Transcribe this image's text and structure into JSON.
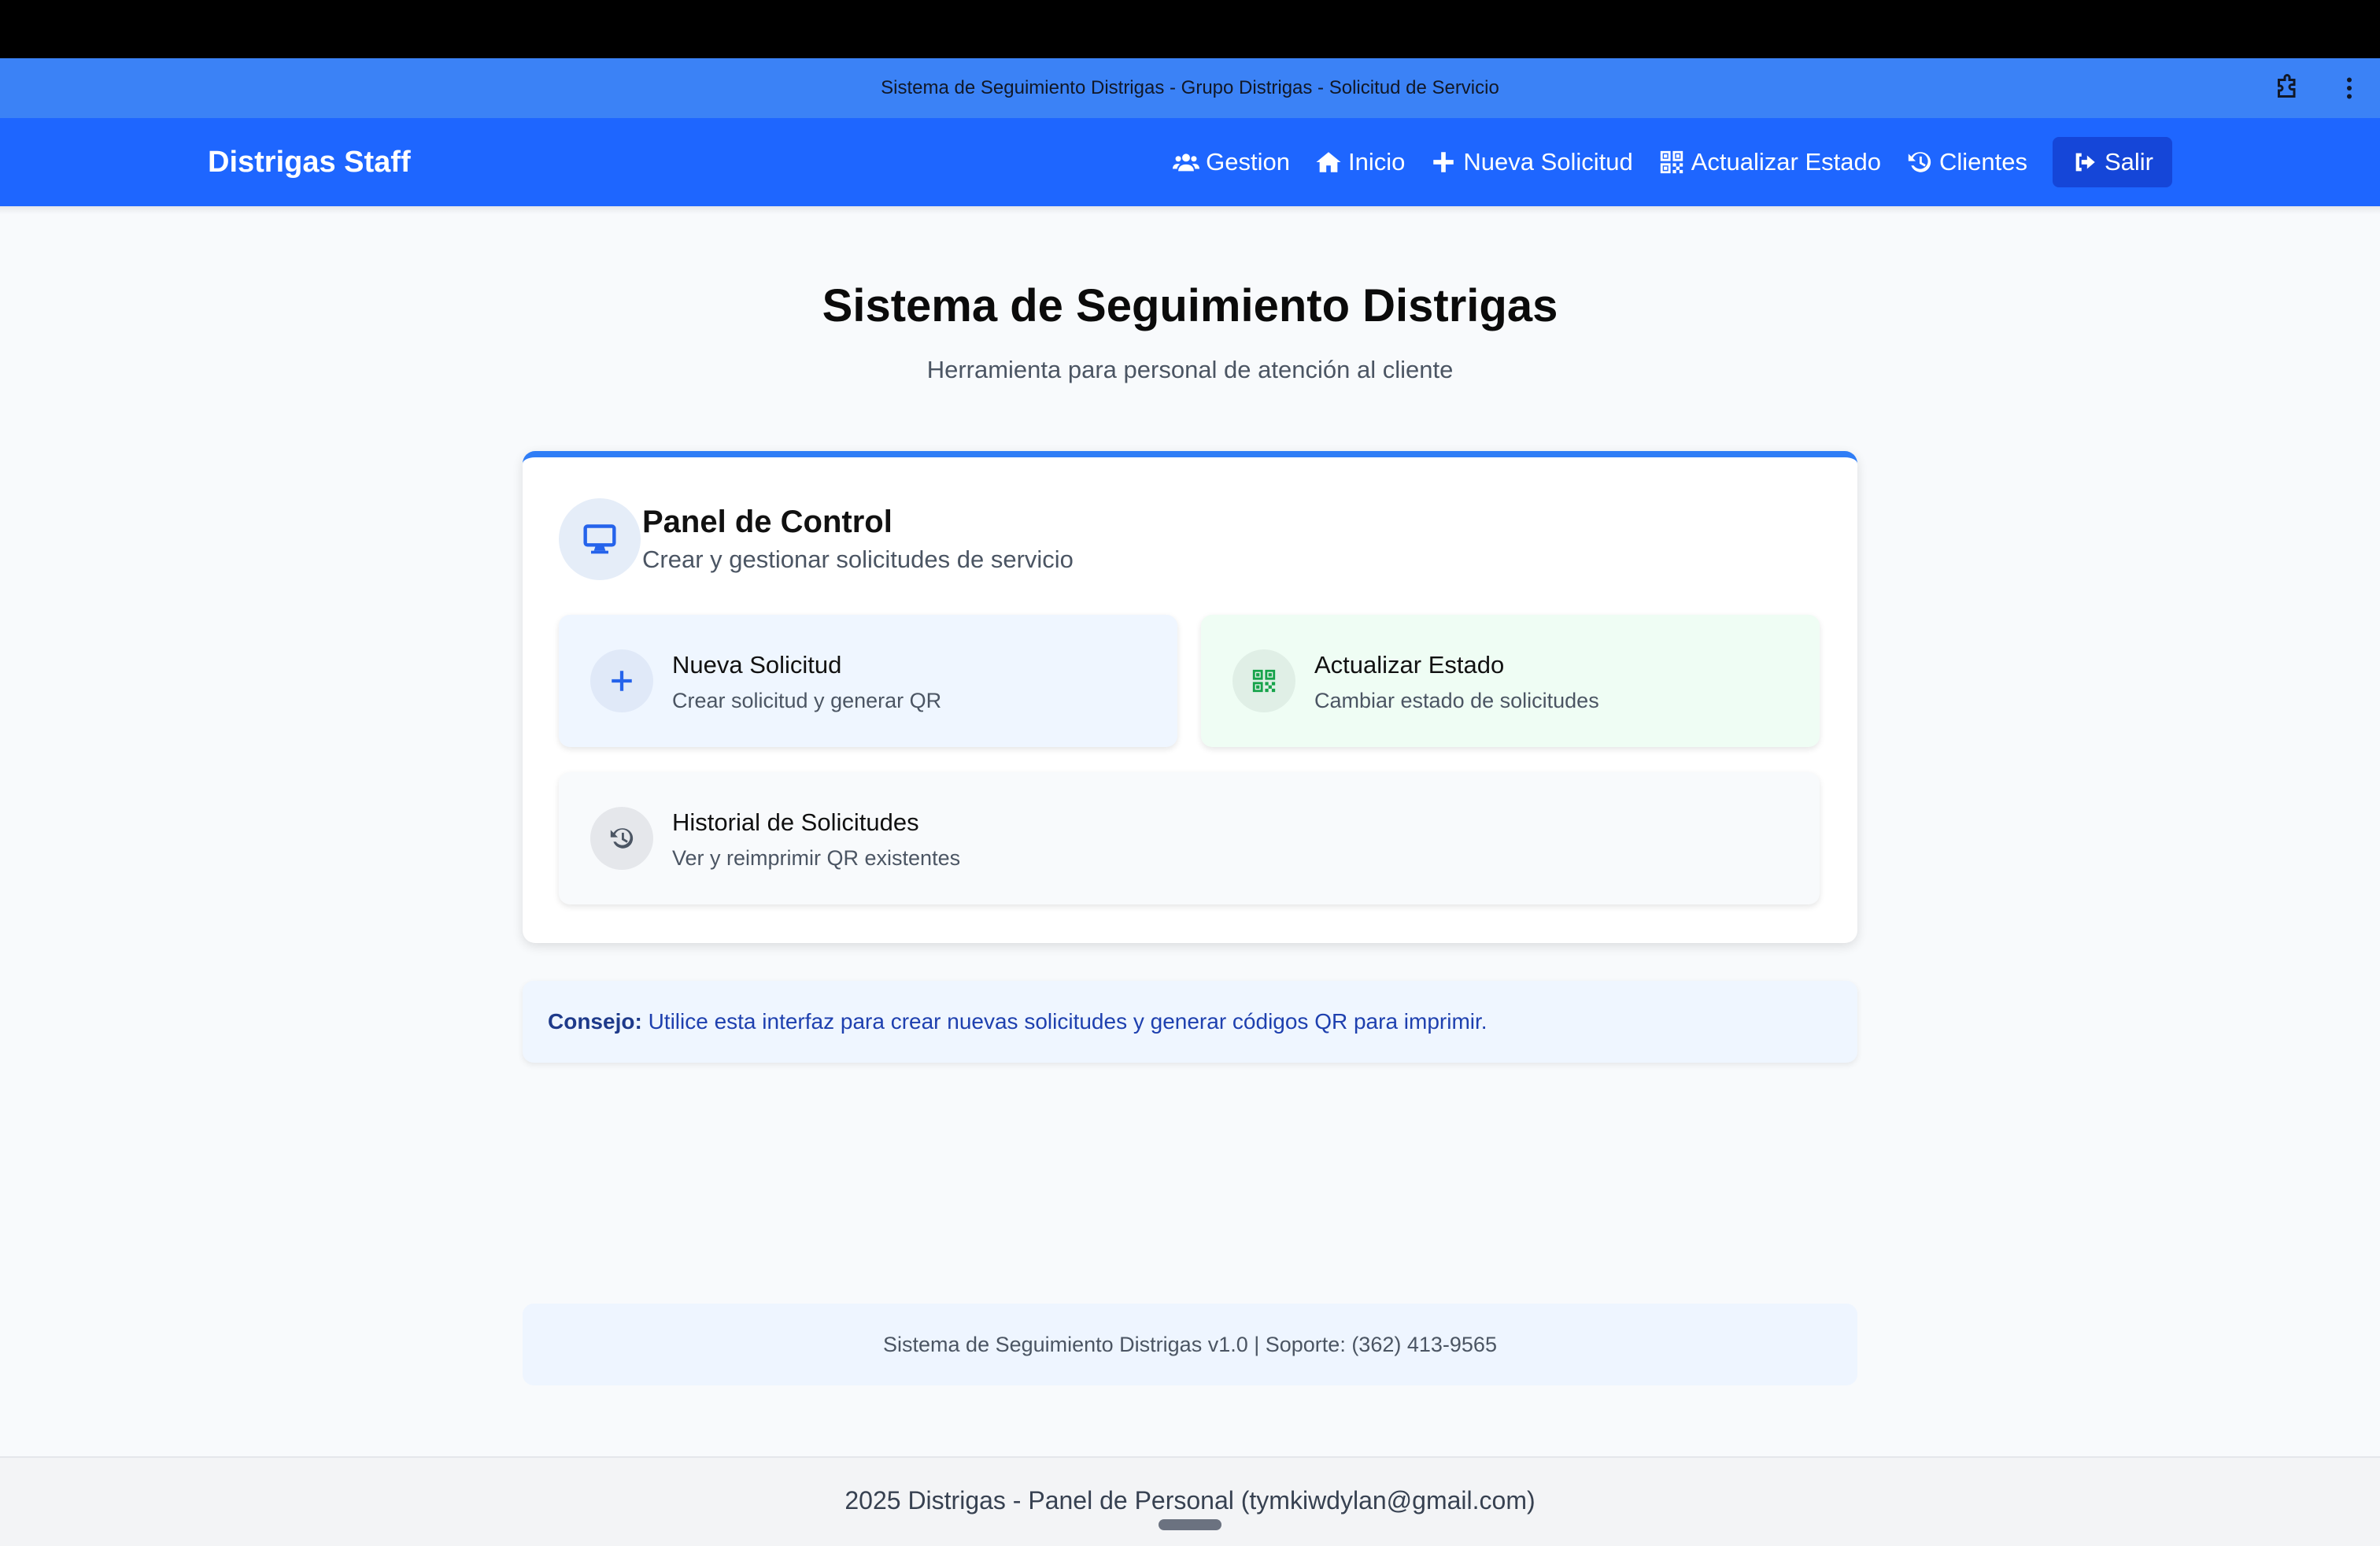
{
  "window": {
    "title": "Sistema de Seguimiento Distrigas - Grupo Distrigas - Solicitud de Servicio",
    "extension_icon": "puzzle-icon",
    "menu_icon": "kebab-menu-icon"
  },
  "navbar": {
    "brand": "Distrigas Staff",
    "items": [
      {
        "label": "Gestion",
        "icon": "users-icon"
      },
      {
        "label": "Inicio",
        "icon": "home-icon"
      },
      {
        "label": "Nueva Solicitud",
        "icon": "plus-icon"
      },
      {
        "label": "Actualizar Estado",
        "icon": "qrcode-icon"
      },
      {
        "label": "Clientes",
        "icon": "history-icon"
      },
      {
        "label": "Salir",
        "icon": "sign-out-icon"
      }
    ]
  },
  "hero": {
    "title": "Sistema de Seguimiento Distrigas",
    "subtitle": "Herramienta para personal de atención al cliente"
  },
  "panel": {
    "title": "Panel de Control",
    "subtitle": "Crear y gestionar solicitudes de servicio",
    "icon": "desktop-icon",
    "tiles": [
      {
        "title": "Nueva Solicitud",
        "subtitle": "Crear solicitud y generar QR",
        "icon": "plus-icon"
      },
      {
        "title": "Actualizar Estado",
        "subtitle": "Cambiar estado de solicitudes",
        "icon": "qrcode-icon"
      },
      {
        "title": "Historial de Solicitudes",
        "subtitle": "Ver y reimprimir QR existentes",
        "icon": "history-icon"
      }
    ]
  },
  "tip": {
    "label": "Consejo:",
    "text": "Utilice esta interfaz para crear nuevas solicitudes y generar códigos QR para imprimir."
  },
  "version": "Sistema de Seguimiento Distrigas v1.0 | Soporte: (362) 413-9565",
  "footer": "2025 Distrigas - Panel de Personal (tymkiwdylan@gmail.com)",
  "colors": {
    "navbar": "#1e66ff",
    "titlebar": "#3b82f6",
    "accent_blue": "#2563eb",
    "accent_green": "#16a34a",
    "tip_text": "#1e40af"
  }
}
